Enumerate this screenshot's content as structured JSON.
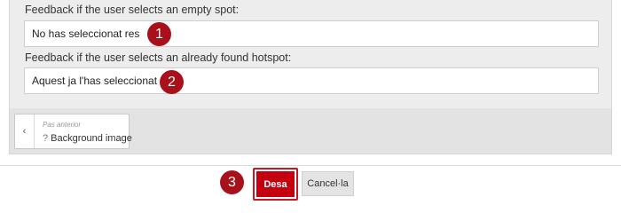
{
  "feedback": {
    "empty_spot_label": "Feedback if the user selects an empty spot:",
    "empty_spot_value": "No has seleccionat res",
    "found_hotspot_label": "Feedback if the user selects an already found hotspot:",
    "found_hotspot_value": "Aquest ja l'has seleccionat"
  },
  "callouts": [
    "1",
    "2",
    "3"
  ],
  "previous_step": {
    "arrow": "‹",
    "caption": "Pas anterior",
    "help_glyph": "?",
    "title": "Background image"
  },
  "actions": {
    "save_label": "Desa",
    "cancel_label": "Cancel·la"
  },
  "colors": {
    "accent": "#c4000e",
    "callout": "#a8101a"
  }
}
